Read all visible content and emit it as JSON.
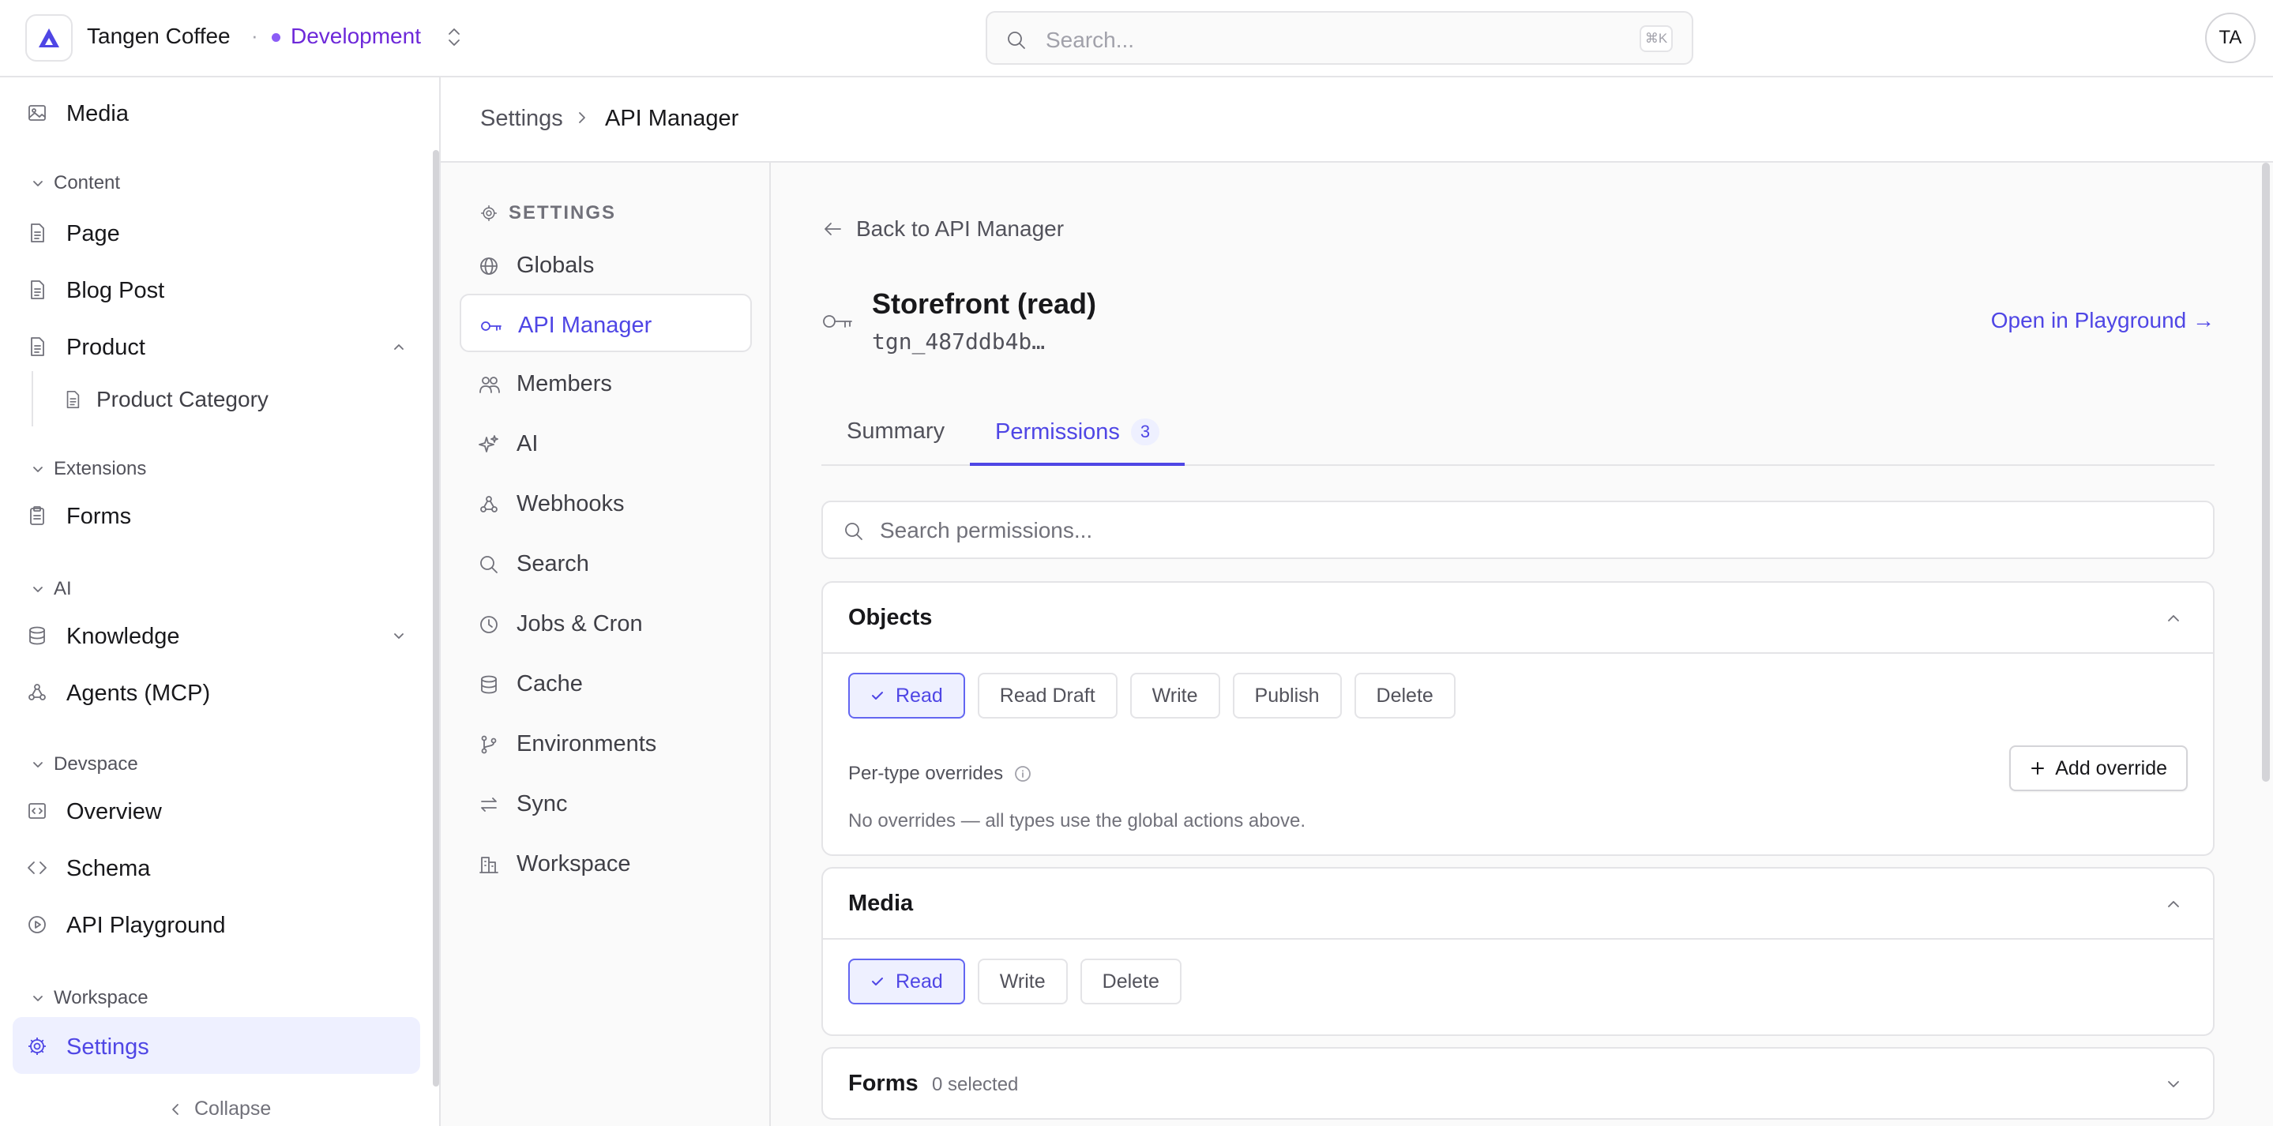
{
  "topbar": {
    "org_name": "Tangen Coffee",
    "separator": "·",
    "environment": "Development",
    "search_placeholder": "Search...",
    "search_shortcut": "⌘K",
    "avatar_initials": "TA"
  },
  "sidebar": {
    "media": "Media",
    "sections": {
      "content": "Content",
      "extensions": "Extensions",
      "ai": "AI",
      "devspace": "Devspace",
      "workspace": "Workspace"
    },
    "items": {
      "page": "Page",
      "blog_post": "Blog Post",
      "product": "Product",
      "product_category": "Product Category",
      "forms": "Forms",
      "knowledge": "Knowledge",
      "agents": "Agents (MCP)",
      "overview": "Overview",
      "schema": "Schema",
      "api_playground": "API Playground",
      "settings": "Settings"
    },
    "collapse": "Collapse"
  },
  "breadcrumb": {
    "root": "Settings",
    "current": "API Manager"
  },
  "settings_nav": {
    "title": "SETTINGS",
    "items": {
      "globals": "Globals",
      "api_manager": "API Manager",
      "members": "Members",
      "ai": "AI",
      "webhooks": "Webhooks",
      "search": "Search",
      "jobs": "Jobs & Cron",
      "cache": "Cache",
      "environments": "Environments",
      "sync": "Sync",
      "workspace": "Workspace"
    }
  },
  "main": {
    "back": "Back to API Manager",
    "key_name": "Storefront (read)",
    "key_id": "tgn_487ddb4b…",
    "open_playground": "Open in Playground →",
    "tabs": {
      "summary": "Summary",
      "permissions": "Permissions",
      "permissions_count": "3"
    },
    "perm_search_placeholder": "Search permissions...",
    "objects": {
      "title": "Objects",
      "actions": {
        "read": "Read",
        "read_draft": "Read Draft",
        "write": "Write",
        "publish": "Publish",
        "delete": "Delete"
      },
      "overrides_label": "Per-type overrides",
      "add_override": "Add override",
      "no_overrides": "No overrides — all types use the global actions above."
    },
    "media": {
      "title": "Media",
      "actions": {
        "read": "Read",
        "write": "Write",
        "delete": "Delete"
      }
    },
    "forms": {
      "title": "Forms",
      "selected": "0 selected"
    }
  },
  "colors": {
    "accent": "#4f46e5",
    "accent_bg": "#eef0ff",
    "environment": "#6d28d9",
    "border": "#e4e4e7"
  }
}
